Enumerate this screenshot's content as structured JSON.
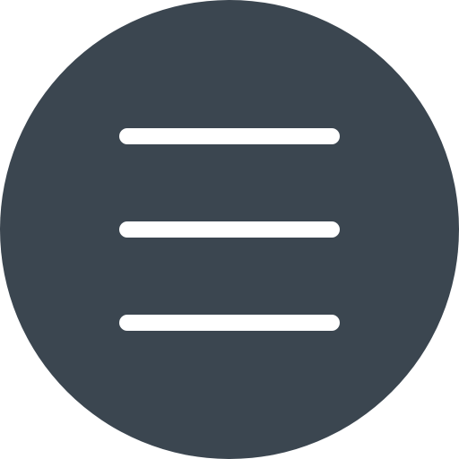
{
  "menu_button": {
    "icon": "hamburger-menu-icon",
    "background_color": "#3b4650",
    "line_color": "#ffffff"
  }
}
